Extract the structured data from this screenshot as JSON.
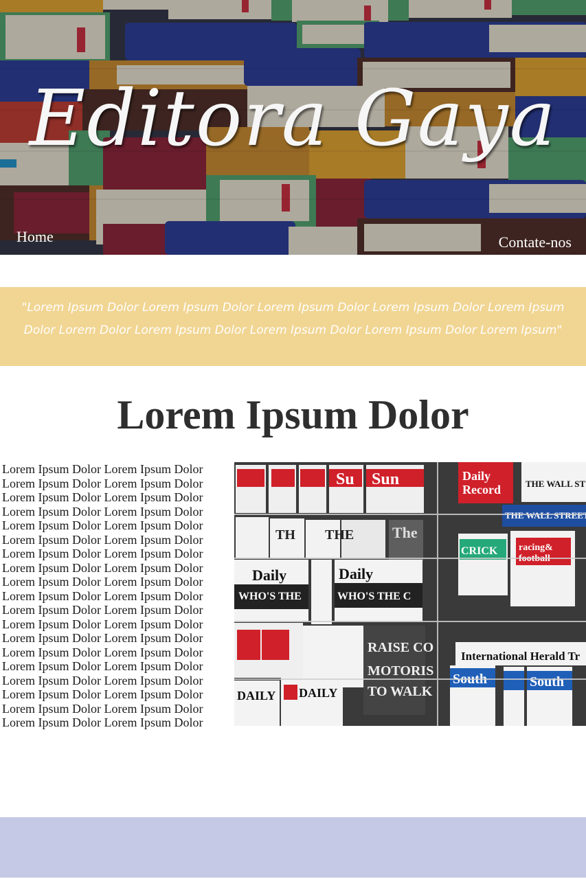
{
  "header": {
    "site_title": "Editora Gaya",
    "nav": {
      "home_label": "Home",
      "contact_label": "Contate-nos"
    }
  },
  "quote": {
    "text": "\"Lorem Ipsum Dolor Lorem Ipsum Dolor Lorem Ipsum Dolor Lorem Ipsum Dolor Lorem Ipsum Dolor Lorem  Dolor Lorem Ipsum Dolor Lorem Ipsum Dolor Lorem Ipsum Dolor Lorem Ipsum\""
  },
  "main": {
    "title": "Lorem Ipsum Dolor",
    "paragraph_lines": [
      "Lorem Ipsum Dolor Lorem Ipsum Dolor",
      "Lorem Ipsum Dolor Lorem Ipsum Dolor",
      "Lorem Ipsum Dolor Lorem Ipsum Dolor",
      "Lorem Ipsum Dolor Lorem Ipsum Dolor",
      "Lorem Ipsum Dolor Lorem Ipsum Dolor",
      "Lorem Ipsum Dolor Lorem Ipsum Dolor",
      "Lorem Ipsum Dolor Lorem Ipsum Dolor",
      "Lorem Ipsum Dolor Lorem Ipsum Dolor",
      "Lorem Ipsum Dolor Lorem Ipsum Dolor",
      "Lorem Ipsum Dolor Lorem Ipsum Dolor",
      "Lorem Ipsum Dolor Lorem Ipsum Dolor",
      "Lorem Ipsum Dolor Lorem Ipsum Dolor",
      "Lorem Ipsum Dolor Lorem Ipsum Dolor",
      "Lorem Ipsum Dolor Lorem Ipsum Dolor",
      "Lorem Ipsum Dolor Lorem Ipsum Dolor",
      "Lorem Ipsum Dolor Lorem Ipsum Dolor",
      "Lorem Ipsum Dolor Lorem Ipsum Dolor",
      "Lorem Ipsum Dolor Lorem Ipsum Dolor",
      "Lorem Ipsum Dolor Lorem Ipsum Dolor"
    ],
    "photo": {
      "newspaper_mastheads": [
        "Sun",
        "Daily Record",
        "THE WALL STREET",
        "THE WALL STREET",
        "Daily Mail",
        "CRICKET",
        "racing & football",
        "The Guardian",
        "International Herald Tribune",
        "South",
        "South",
        "DAILY",
        "DAILY"
      ]
    }
  },
  "colors": {
    "quote_banner": "#f1d592",
    "footer": "#c5c9e5",
    "title_text": "#2e2e2e"
  }
}
